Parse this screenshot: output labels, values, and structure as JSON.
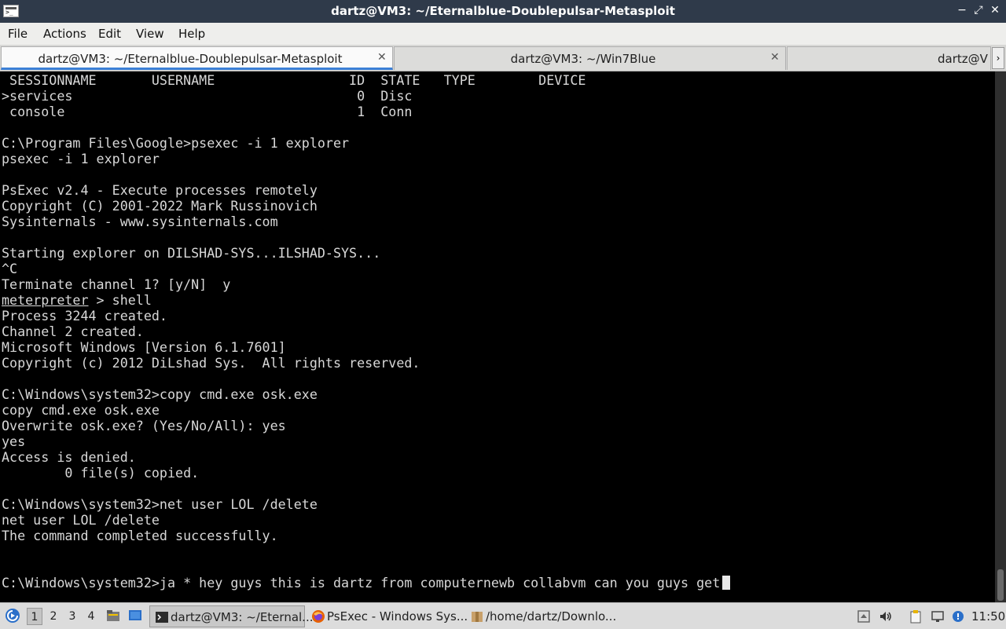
{
  "window": {
    "title": "dartz@VM3: ~/Eternalblue-Doublepulsar-Metasploit",
    "minimize": "−",
    "maximize": "⤢",
    "close": "✕"
  },
  "menu": [
    "File",
    "Actions",
    "Edit",
    "View",
    "Help"
  ],
  "tabs": [
    {
      "label": "dartz@VM3: ~/Eternalblue-Doublepulsar-Metasploit",
      "active": true,
      "close": "✕"
    },
    {
      "label": "dartz@VM3: ~/Win7Blue",
      "active": false,
      "close": "✕"
    },
    {
      "label": "dartz@V",
      "active": false
    },
    {
      "scroll": "›"
    }
  ],
  "terminal": {
    "lines": [
      " SESSIONNAME       USERNAME                 ID  STATE   TYPE        DEVICE",
      ">services                                    0  Disc",
      " console                                     1  Conn",
      "",
      "C:\\Program Files\\Google>psexec -i 1 explorer",
      "psexec -i 1 explorer",
      "",
      "PsExec v2.4 - Execute processes remotely",
      "Copyright (C) 2001-2022 Mark Russinovich",
      "Sysinternals - www.sysinternals.com",
      "",
      "Starting explorer on DILSHAD-SYS...ILSHAD-SYS...",
      "^C",
      "Terminate channel 1? [y/N]  y",
      "",
      "Process 3244 created.",
      "Channel 2 created.",
      "Microsoft Windows [Version 6.1.7601]",
      "Copyright (c) 2012 DiLshad Sys.  All rights reserved.",
      "",
      "C:\\Windows\\system32>copy cmd.exe osk.exe",
      "copy cmd.exe osk.exe",
      "Overwrite osk.exe? (Yes/No/All): yes",
      "yes",
      "Access is denied.",
      "        0 file(s) copied.",
      "",
      "C:\\Windows\\system32>net user LOL /delete",
      "net user LOL /delete",
      "The command completed successfully.",
      "",
      "",
      "C:\\Windows\\system32>ja * hey guys this is dartz from computernewb collabvm can you guys get"
    ],
    "meterpreter_prompt": "meterpreter",
    "meterpreter_cmd": " > shell"
  },
  "taskbar": {
    "workspaces": [
      "1",
      "2",
      "3",
      "4"
    ],
    "active_workspace": "1",
    "tasks": [
      {
        "label": "dartz@VM3: ~/Eternal...",
        "icon": "terminal-icon",
        "active": true
      },
      {
        "label": "PsExec - Windows Sys...",
        "icon": "firefox-icon",
        "active": false
      },
      {
        "label": "/home/dartz/Downlo...",
        "icon": "archive-icon",
        "active": false
      }
    ],
    "clock": "11:50"
  },
  "colors": {
    "terminal_bg": "#000000",
    "terminal_fg": "#d8d8d8",
    "titlebar_bg": "#2f3a4a",
    "tab_accent": "#3b7fd6"
  }
}
